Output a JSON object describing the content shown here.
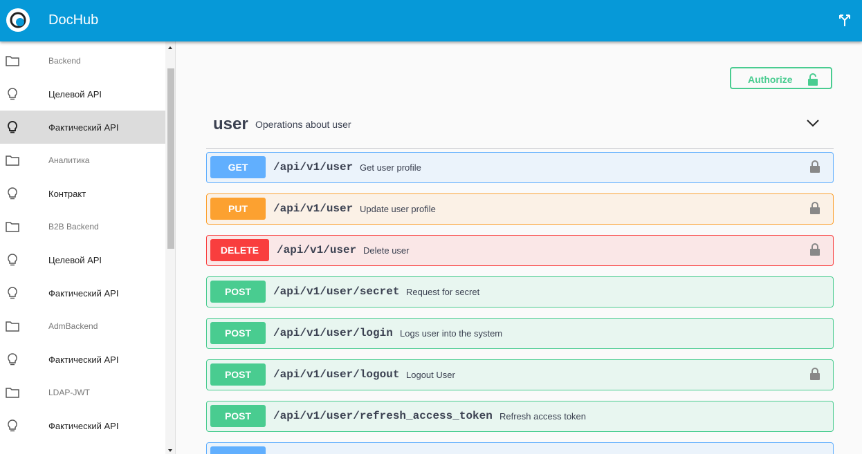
{
  "header": {
    "title": "DocHub",
    "logo_icon": "dochub-logo",
    "right_icon": "fork-icon"
  },
  "sidebar": {
    "items": [
      {
        "label": "Backend",
        "kind": "folder",
        "icon": "folder-icon"
      },
      {
        "label": "Целевой API",
        "kind": "api",
        "icon": "lightbulb-icon"
      },
      {
        "label": "Фактический API",
        "kind": "api",
        "icon": "lightbulb-icon",
        "selected": true
      },
      {
        "label": "Аналитика",
        "kind": "folder",
        "icon": "folder-icon"
      },
      {
        "label": "Контракт",
        "kind": "api",
        "icon": "lightbulb-icon"
      },
      {
        "label": "B2B Backend",
        "kind": "folder",
        "icon": "folder-icon"
      },
      {
        "label": "Целевой API",
        "kind": "api",
        "icon": "lightbulb-icon"
      },
      {
        "label": "Фактический API",
        "kind": "api",
        "icon": "lightbulb-icon"
      },
      {
        "label": "AdmBackend",
        "kind": "folder",
        "icon": "folder-icon"
      },
      {
        "label": "Фактический API",
        "kind": "api",
        "icon": "lightbulb-icon"
      },
      {
        "label": "LDAP-JWT",
        "kind": "folder",
        "icon": "folder-icon"
      },
      {
        "label": "Фактический API",
        "kind": "api",
        "icon": "lightbulb-icon"
      }
    ]
  },
  "main": {
    "authorize_label": "Authorize",
    "tag": {
      "name": "user",
      "description": "Operations about user"
    },
    "operations": [
      {
        "method": "GET",
        "path": "/api/v1/user",
        "summary": "Get user profile",
        "locked": true
      },
      {
        "method": "PUT",
        "path": "/api/v1/user",
        "summary": "Update user profile",
        "locked": true
      },
      {
        "method": "DELETE",
        "path": "/api/v1/user",
        "summary": "Delete user",
        "locked": true
      },
      {
        "method": "POST",
        "path": "/api/v1/user/secret",
        "summary": "Request for secret",
        "locked": false
      },
      {
        "method": "POST",
        "path": "/api/v1/user/login",
        "summary": "Logs user into the system",
        "locked": false
      },
      {
        "method": "POST",
        "path": "/api/v1/user/logout",
        "summary": "Logout User",
        "locked": true
      },
      {
        "method": "POST",
        "path": "/api/v1/user/refresh_access_token",
        "summary": "Refresh access token",
        "locked": false
      }
    ]
  },
  "colors": {
    "header": "#0699d8",
    "get": "#61affe",
    "put": "#fca130",
    "delete": "#f93e3e",
    "post": "#49cc90"
  }
}
